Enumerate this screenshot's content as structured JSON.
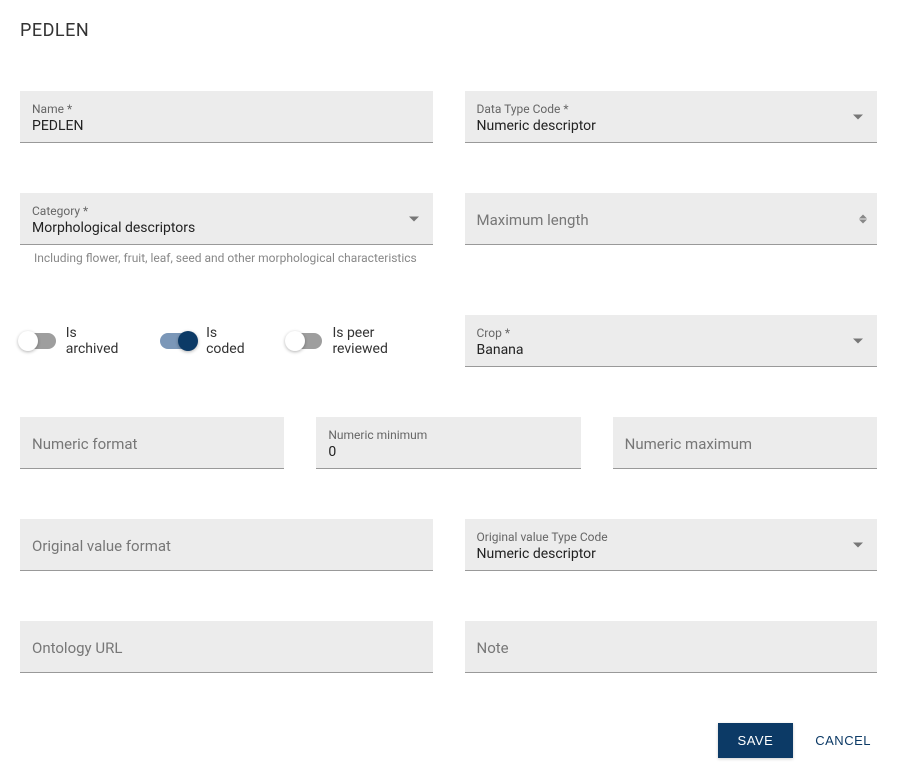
{
  "title": "PEDLEN",
  "fields": {
    "name": {
      "label": "Name *",
      "value": "PEDLEN"
    },
    "dataType": {
      "label": "Data Type Code *",
      "value": "Numeric descriptor"
    },
    "category": {
      "label": "Category *",
      "value": "Morphological descriptors",
      "helper": "Including flower, fruit, leaf, seed and other morphological characteristics"
    },
    "maxLength": {
      "label": "Maximum length"
    },
    "crop": {
      "label": "Crop *",
      "value": "Banana"
    },
    "numericFormat": {
      "label": "Numeric format"
    },
    "numericMin": {
      "label": "Numeric minimum",
      "value": "0"
    },
    "numericMax": {
      "label": "Numeric maximum"
    },
    "originalValueFormat": {
      "label": "Original value format"
    },
    "originalValueType": {
      "label": "Original value Type Code",
      "value": "Numeric descriptor"
    },
    "ontologyUrl": {
      "label": "Ontology URL"
    },
    "note": {
      "label": "Note"
    }
  },
  "toggles": {
    "isArchived": {
      "label": "Is archived",
      "on": false
    },
    "isCoded": {
      "label": "Is coded",
      "on": true
    },
    "isPeerReviewed": {
      "label": "Is peer reviewed",
      "on": false
    }
  },
  "actions": {
    "save": "SAVE",
    "cancel": "CANCEL"
  }
}
